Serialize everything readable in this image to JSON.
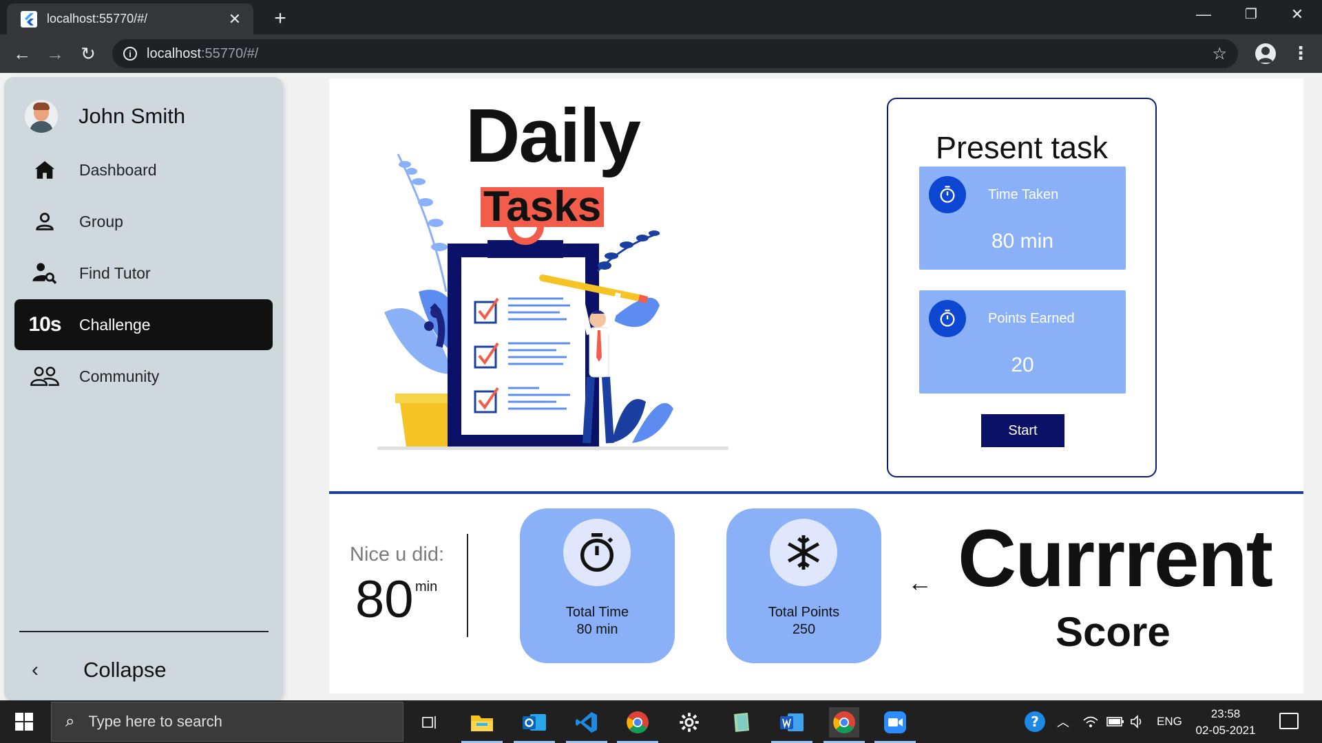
{
  "browser": {
    "tab_title": "localhost:55770/#/",
    "url_host": "localhost",
    "url_rest": ":55770/#/"
  },
  "sidebar": {
    "user_name": "John Smith",
    "items": [
      {
        "label": "Dashboard",
        "icon": "home-icon"
      },
      {
        "label": "Group",
        "icon": "person-icon"
      },
      {
        "label": "Find Tutor",
        "icon": "person-search-icon"
      },
      {
        "label": "Challenge",
        "icon": "timer-10s-icon",
        "icon_text": "10s",
        "active": true
      },
      {
        "label": "Community",
        "icon": "people-icon"
      }
    ],
    "collapse_label": "Collapse"
  },
  "hero": {
    "title_word": "Daily",
    "subtitle_word": "Tasks"
  },
  "present_task": {
    "title": "Present task",
    "time_taken_label": "Time Taken",
    "time_taken_value": "80 min",
    "points_label": "Points Earned",
    "points_value": "20",
    "start_label": "Start"
  },
  "summary": {
    "nice_label": "Nice u did:",
    "nice_value": "80",
    "nice_unit": "min",
    "total_time_title": "Total Time",
    "total_time_value": "80 min",
    "total_points_title": "Total Points",
    "total_points_value": "250",
    "current_word": "Currrent",
    "score_word": "Score"
  },
  "taskbar": {
    "search_placeholder": "Type here to search",
    "lang": "ENG",
    "time": "23:58",
    "date": "02-05-2021"
  },
  "colors": {
    "accent_blue": "#8ab0f8",
    "navy": "#0a1166",
    "sidebar_bg": "#cfd8dc",
    "active_item": "#111111",
    "tasks_highlight": "#f25c4b"
  }
}
